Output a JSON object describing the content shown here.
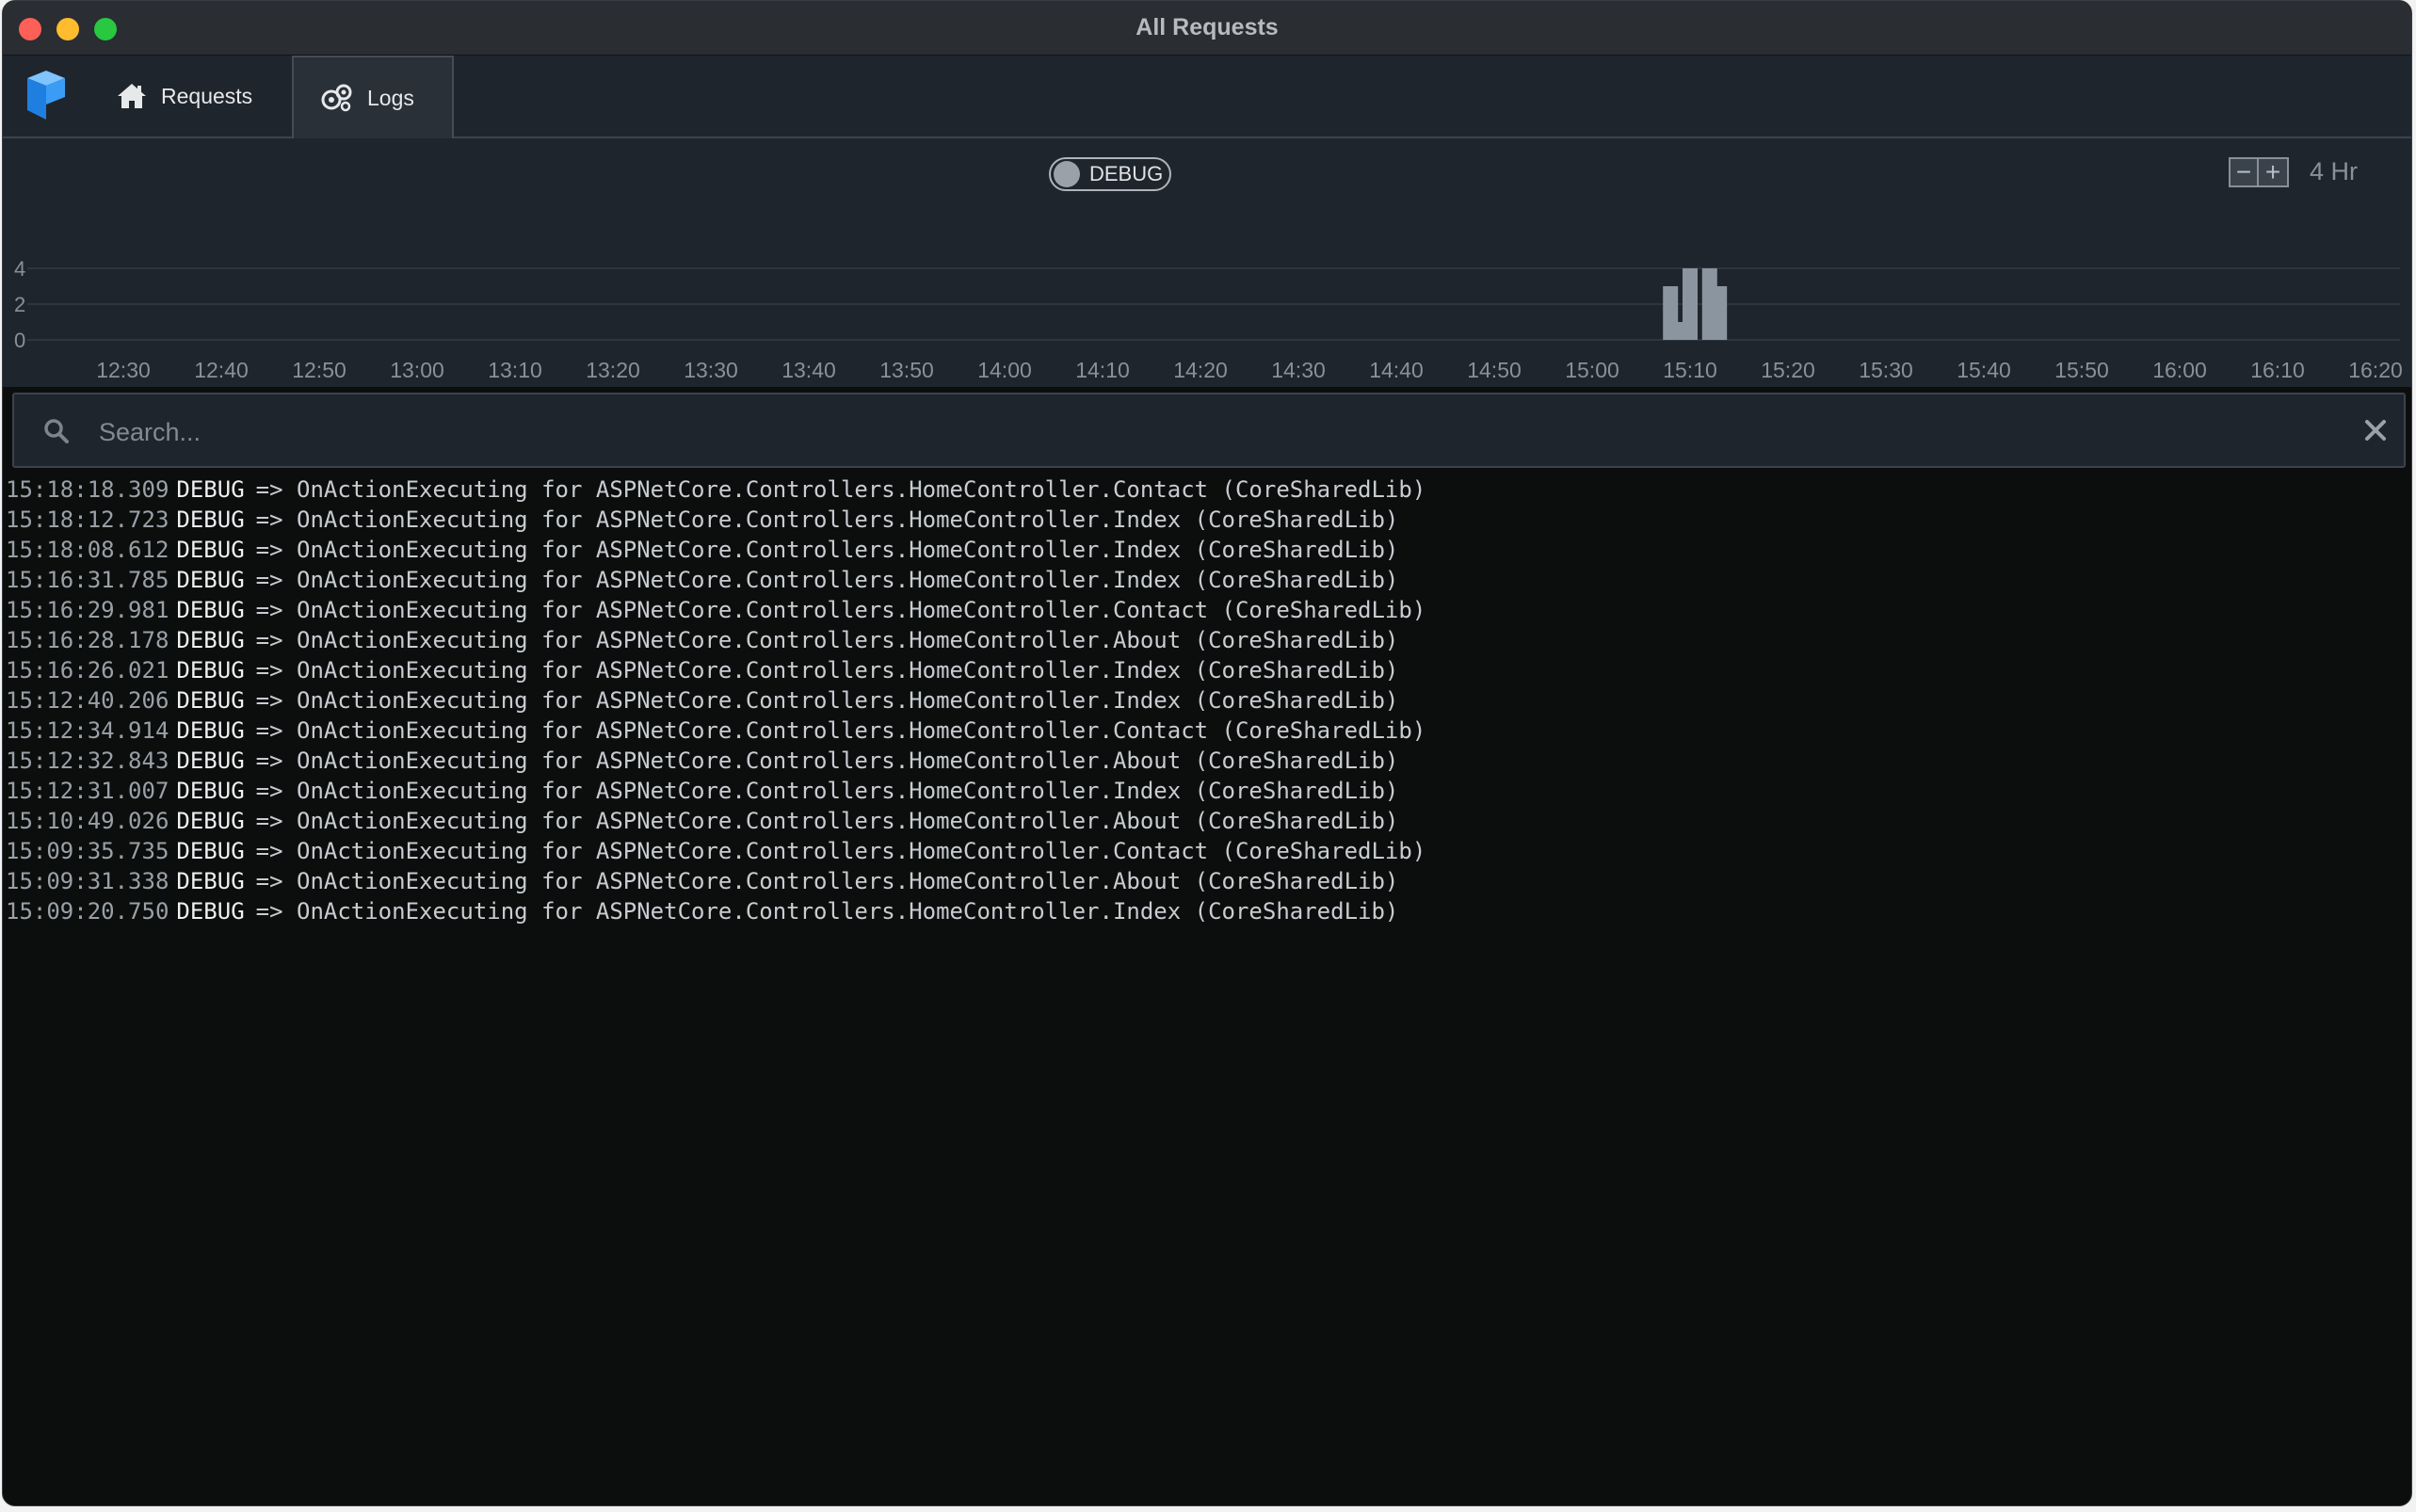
{
  "window": {
    "title": "All Requests"
  },
  "tabs": {
    "requests": "Requests",
    "logs": "Logs"
  },
  "toggle": {
    "label": "DEBUG",
    "on": false
  },
  "zoom": {
    "minus": "−",
    "plus": "+",
    "range_label": "4 Hr"
  },
  "chart_data": {
    "type": "bar",
    "x_ticks": [
      "12:30",
      "12:40",
      "12:50",
      "13:00",
      "13:10",
      "13:20",
      "13:30",
      "13:40",
      "13:50",
      "14:00",
      "14:10",
      "14:20",
      "14:30",
      "14:40",
      "14:50",
      "15:00",
      "15:10",
      "15:20",
      "15:30",
      "15:40",
      "15:50",
      "16:00",
      "16:10",
      "16:20"
    ],
    "y_ticks": [
      0,
      2,
      4
    ],
    "ylim": [
      0,
      4
    ],
    "bars": [
      {
        "time": "15:08",
        "value": 3
      },
      {
        "time": "15:09",
        "value": 1
      },
      {
        "time": "15:10",
        "value": 4
      },
      {
        "time": "15:12",
        "value": 4
      },
      {
        "time": "15:13",
        "value": 3
      }
    ],
    "grid": true,
    "bar_color": "#8b95a0"
  },
  "search": {
    "placeholder": "Search..."
  },
  "logs": [
    {
      "time": "15:18:18.309",
      "level": "DEBUG",
      "message": "=> OnActionExecuting for ASPNetCore.Controllers.HomeController.Contact (CoreSharedLib)"
    },
    {
      "time": "15:18:12.723",
      "level": "DEBUG",
      "message": "=> OnActionExecuting for ASPNetCore.Controllers.HomeController.Index (CoreSharedLib)"
    },
    {
      "time": "15:18:08.612",
      "level": "DEBUG",
      "message": "=> OnActionExecuting for ASPNetCore.Controllers.HomeController.Index (CoreSharedLib)"
    },
    {
      "time": "15:16:31.785",
      "level": "DEBUG",
      "message": "=> OnActionExecuting for ASPNetCore.Controllers.HomeController.Index (CoreSharedLib)"
    },
    {
      "time": "15:16:29.981",
      "level": "DEBUG",
      "message": "=> OnActionExecuting for ASPNetCore.Controllers.HomeController.Contact (CoreSharedLib)"
    },
    {
      "time": "15:16:28.178",
      "level": "DEBUG",
      "message": "=> OnActionExecuting for ASPNetCore.Controllers.HomeController.About (CoreSharedLib)"
    },
    {
      "time": "15:16:26.021",
      "level": "DEBUG",
      "message": "=> OnActionExecuting for ASPNetCore.Controllers.HomeController.Index (CoreSharedLib)"
    },
    {
      "time": "15:12:40.206",
      "level": "DEBUG",
      "message": "=> OnActionExecuting for ASPNetCore.Controllers.HomeController.Index (CoreSharedLib)"
    },
    {
      "time": "15:12:34.914",
      "level": "DEBUG",
      "message": "=> OnActionExecuting for ASPNetCore.Controllers.HomeController.Contact (CoreSharedLib)"
    },
    {
      "time": "15:12:32.843",
      "level": "DEBUG",
      "message": "=> OnActionExecuting for ASPNetCore.Controllers.HomeController.About (CoreSharedLib)"
    },
    {
      "time": "15:12:31.007",
      "level": "DEBUG",
      "message": "=> OnActionExecuting for ASPNetCore.Controllers.HomeController.Index (CoreSharedLib)"
    },
    {
      "time": "15:10:49.026",
      "level": "DEBUG",
      "message": "=> OnActionExecuting for ASPNetCore.Controllers.HomeController.About (CoreSharedLib)"
    },
    {
      "time": "15:09:35.735",
      "level": "DEBUG",
      "message": "=> OnActionExecuting for ASPNetCore.Controllers.HomeController.Contact (CoreSharedLib)"
    },
    {
      "time": "15:09:31.338",
      "level": "DEBUG",
      "message": "=> OnActionExecuting for ASPNetCore.Controllers.HomeController.About (CoreSharedLib)"
    },
    {
      "time": "15:09:20.750",
      "level": "DEBUG",
      "message": "=> OnActionExecuting for ASPNetCore.Controllers.HomeController.Index (CoreSharedLib)"
    }
  ]
}
